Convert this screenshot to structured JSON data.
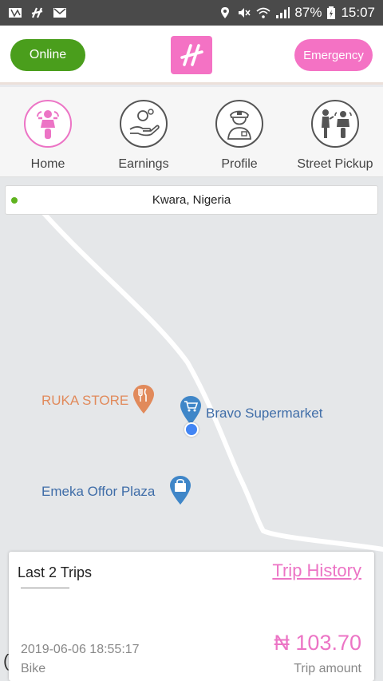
{
  "status_bar": {
    "battery": "87%",
    "time": "15:07"
  },
  "header": {
    "online_label": "Online",
    "emergency_label": "Emergency"
  },
  "nav": {
    "items": [
      {
        "label": "Home",
        "icon": "motorbike-rider-icon",
        "active": true
      },
      {
        "label": "Earnings",
        "icon": "hand-coin-icon",
        "active": false
      },
      {
        "label": "Profile",
        "icon": "officer-icon",
        "active": false
      },
      {
        "label": "Street Pickup",
        "icon": "person-motorbike-icon",
        "active": false
      }
    ]
  },
  "map": {
    "location": "Kwara, Nigeria",
    "pois": [
      {
        "name": "RUKA STORE",
        "icon": "restaurant-icon",
        "color": "#e18a5b"
      },
      {
        "name": "Bravo Supermarket",
        "icon": "cart-icon",
        "color": "#3f86c8"
      },
      {
        "name": "Emeka Offor Plaza",
        "icon": "shopping-bag-icon",
        "color": "#3f86c8"
      }
    ]
  },
  "trips": {
    "title": "Last 2 Trips",
    "history_label": "Trip History",
    "items": [
      {
        "date": "2019-06-06 18:55:17",
        "type": "Bike",
        "amount": "₦  103.70",
        "amount_label": "Trip amount"
      }
    ]
  },
  "colors": {
    "brand_pink": "#f472c4",
    "online_green": "#4a9e1c",
    "poi_orange": "#e18a5b",
    "poi_blue": "#3f86c8"
  }
}
